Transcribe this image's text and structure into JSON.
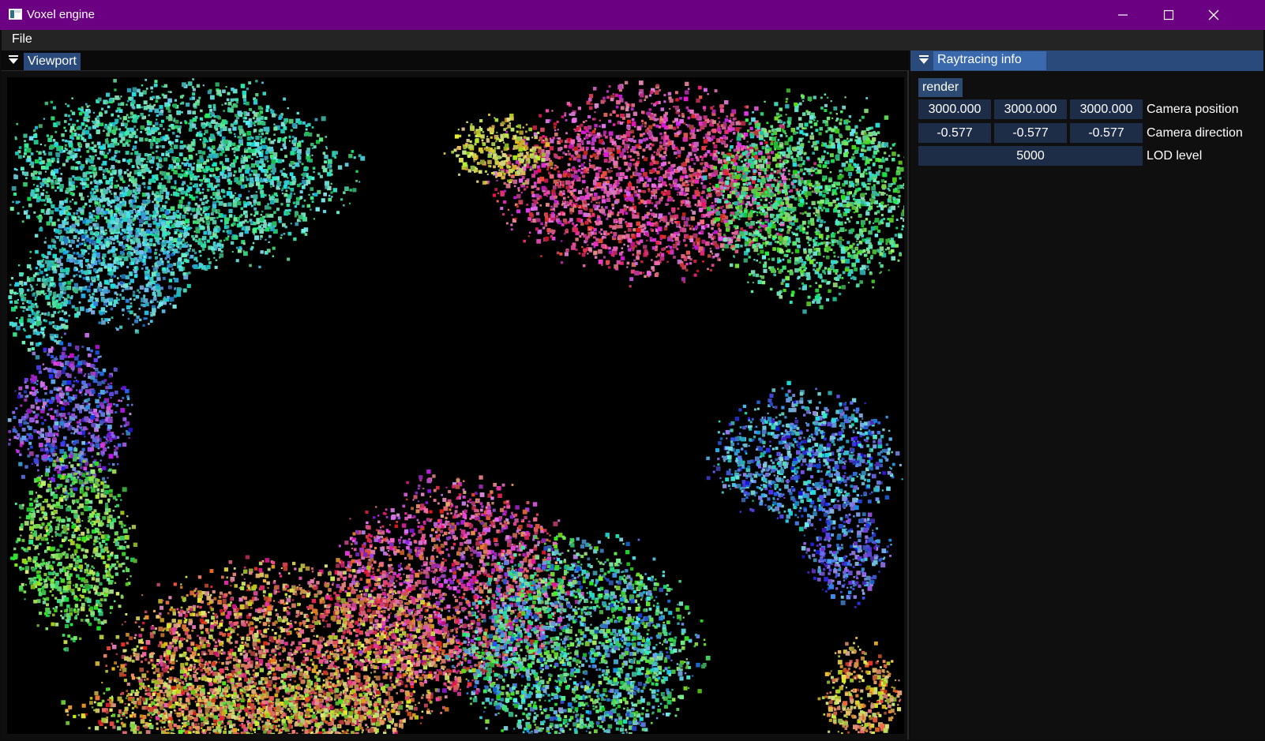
{
  "window": {
    "title": "Voxel engine",
    "icons": {
      "app": "app-window-icon",
      "minimize": "minimize-icon",
      "maximize": "maximize-icon",
      "close": "close-icon"
    },
    "colors": {
      "titlebar": "#6b0082",
      "panel_accent": "#294a7a",
      "field": "#1d2d47"
    }
  },
  "menubar": {
    "items": [
      {
        "label": "File"
      }
    ]
  },
  "viewport": {
    "tab_label": "Viewport",
    "collapse_icon": "collapse-triangle-icon",
    "content": "raytraced voxel render"
  },
  "raytracing": {
    "title": "Raytracing info",
    "collapse_icon": "collapse-triangle-icon",
    "render_label": "render",
    "camera_position": {
      "values": [
        "3000.000",
        "3000.000",
        "3000.000"
      ],
      "label": "Camera position"
    },
    "camera_direction": {
      "values": [
        "-0.577",
        "-0.577",
        "-0.577"
      ],
      "label": "Camera direction"
    },
    "lod": {
      "value": "5000",
      "label": "LOD level"
    }
  }
}
